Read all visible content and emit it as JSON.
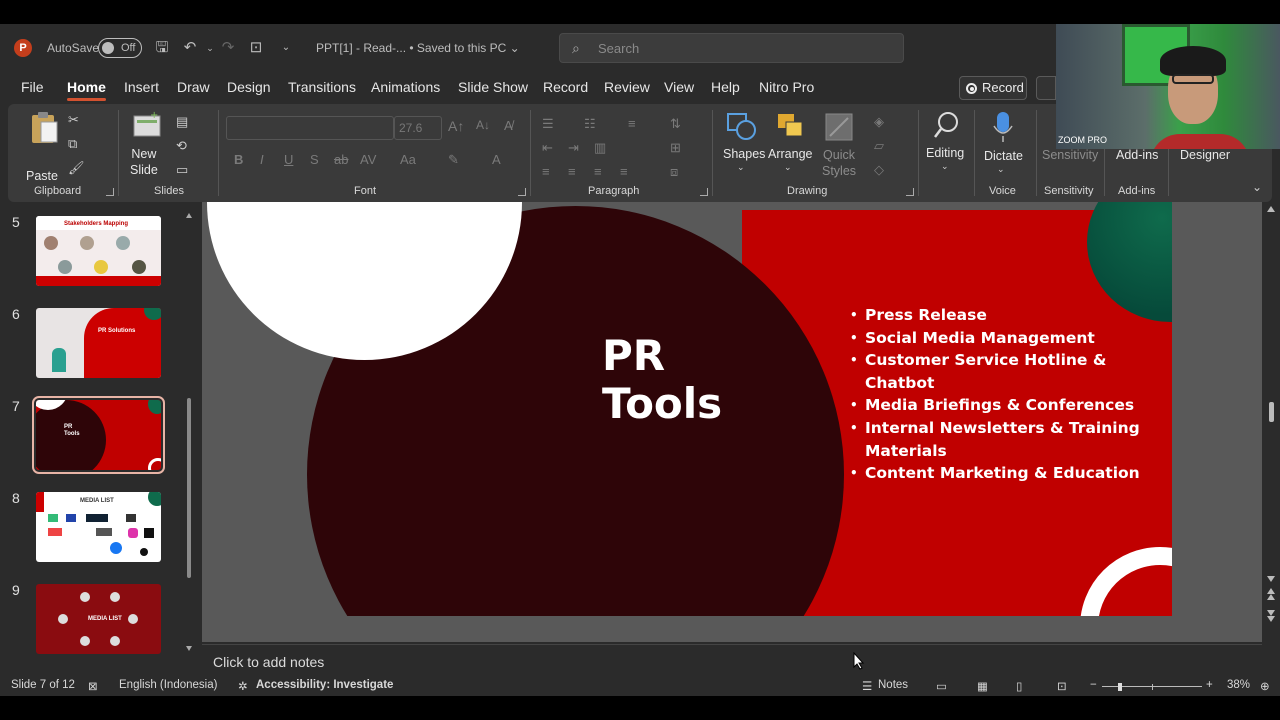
{
  "titlebar": {
    "app_logo": "P",
    "autosave_label": "AutoSave",
    "autosave_state": "Off",
    "doc_title": "PPT[1]  -  Read-...   •  Saved to this PC ⌄",
    "search_placeholder": "Search"
  },
  "menu": {
    "tabs": [
      "File",
      "Home",
      "Insert",
      "Draw",
      "Design",
      "Transitions",
      "Animations",
      "Slide Show",
      "Record",
      "Review",
      "View",
      "Help",
      "Nitro Pro"
    ],
    "active": "Home",
    "record_button": "Record"
  },
  "ribbon": {
    "clipboard": {
      "paste": "Paste",
      "group": "Clipboard"
    },
    "slides": {
      "new_slide": "New\nSlide",
      "group": "Slides"
    },
    "font": {
      "size": "27.6",
      "group": "Font"
    },
    "paragraph": {
      "group": "Paragraph"
    },
    "drawing": {
      "shapes": "Shapes",
      "arrange": "Arrange",
      "quick_styles": "Quick\nStyles",
      "group": "Drawing"
    },
    "editing": {
      "label": "Editing"
    },
    "voice": {
      "dictate": "Dictate",
      "group": "Voice"
    },
    "sensitivity": {
      "label": "Sensitivity",
      "group": "Sensitivity"
    },
    "addins": {
      "label": "Add-ins",
      "group": "Add-ins"
    },
    "designer": {
      "label": "Designer"
    }
  },
  "thumbnails": [
    {
      "num": "5",
      "title": "Stakeholders Mapping"
    },
    {
      "num": "6",
      "title": "PR Solutions"
    },
    {
      "num": "7",
      "title": "PR\nTools"
    },
    {
      "num": "8",
      "title": "MEDIA LIST"
    },
    {
      "num": "9",
      "title": "MEDIA LIST"
    }
  ],
  "slide": {
    "title_line1": "PR",
    "title_line2": "Tools",
    "bullets": [
      "Press Release",
      "Social Media Management",
      "Customer Service Hotline & Chatbot",
      "Media Briefings & Conferences",
      "Internal Newsletters & Training Materials",
      "Content Marketing & Education"
    ],
    "colors": {
      "red": "#c00000",
      "dark": "#2e0508",
      "green": "#0f6b4c"
    }
  },
  "notes": {
    "placeholder": "Click to add notes"
  },
  "status": {
    "slide_count": "Slide 7 of 12",
    "language": "English (Indonesia)",
    "accessibility": "Accessibility: Investigate",
    "notes_button": "Notes",
    "zoom": "38%"
  },
  "overlay": {
    "label": "ZOOM PRO"
  }
}
